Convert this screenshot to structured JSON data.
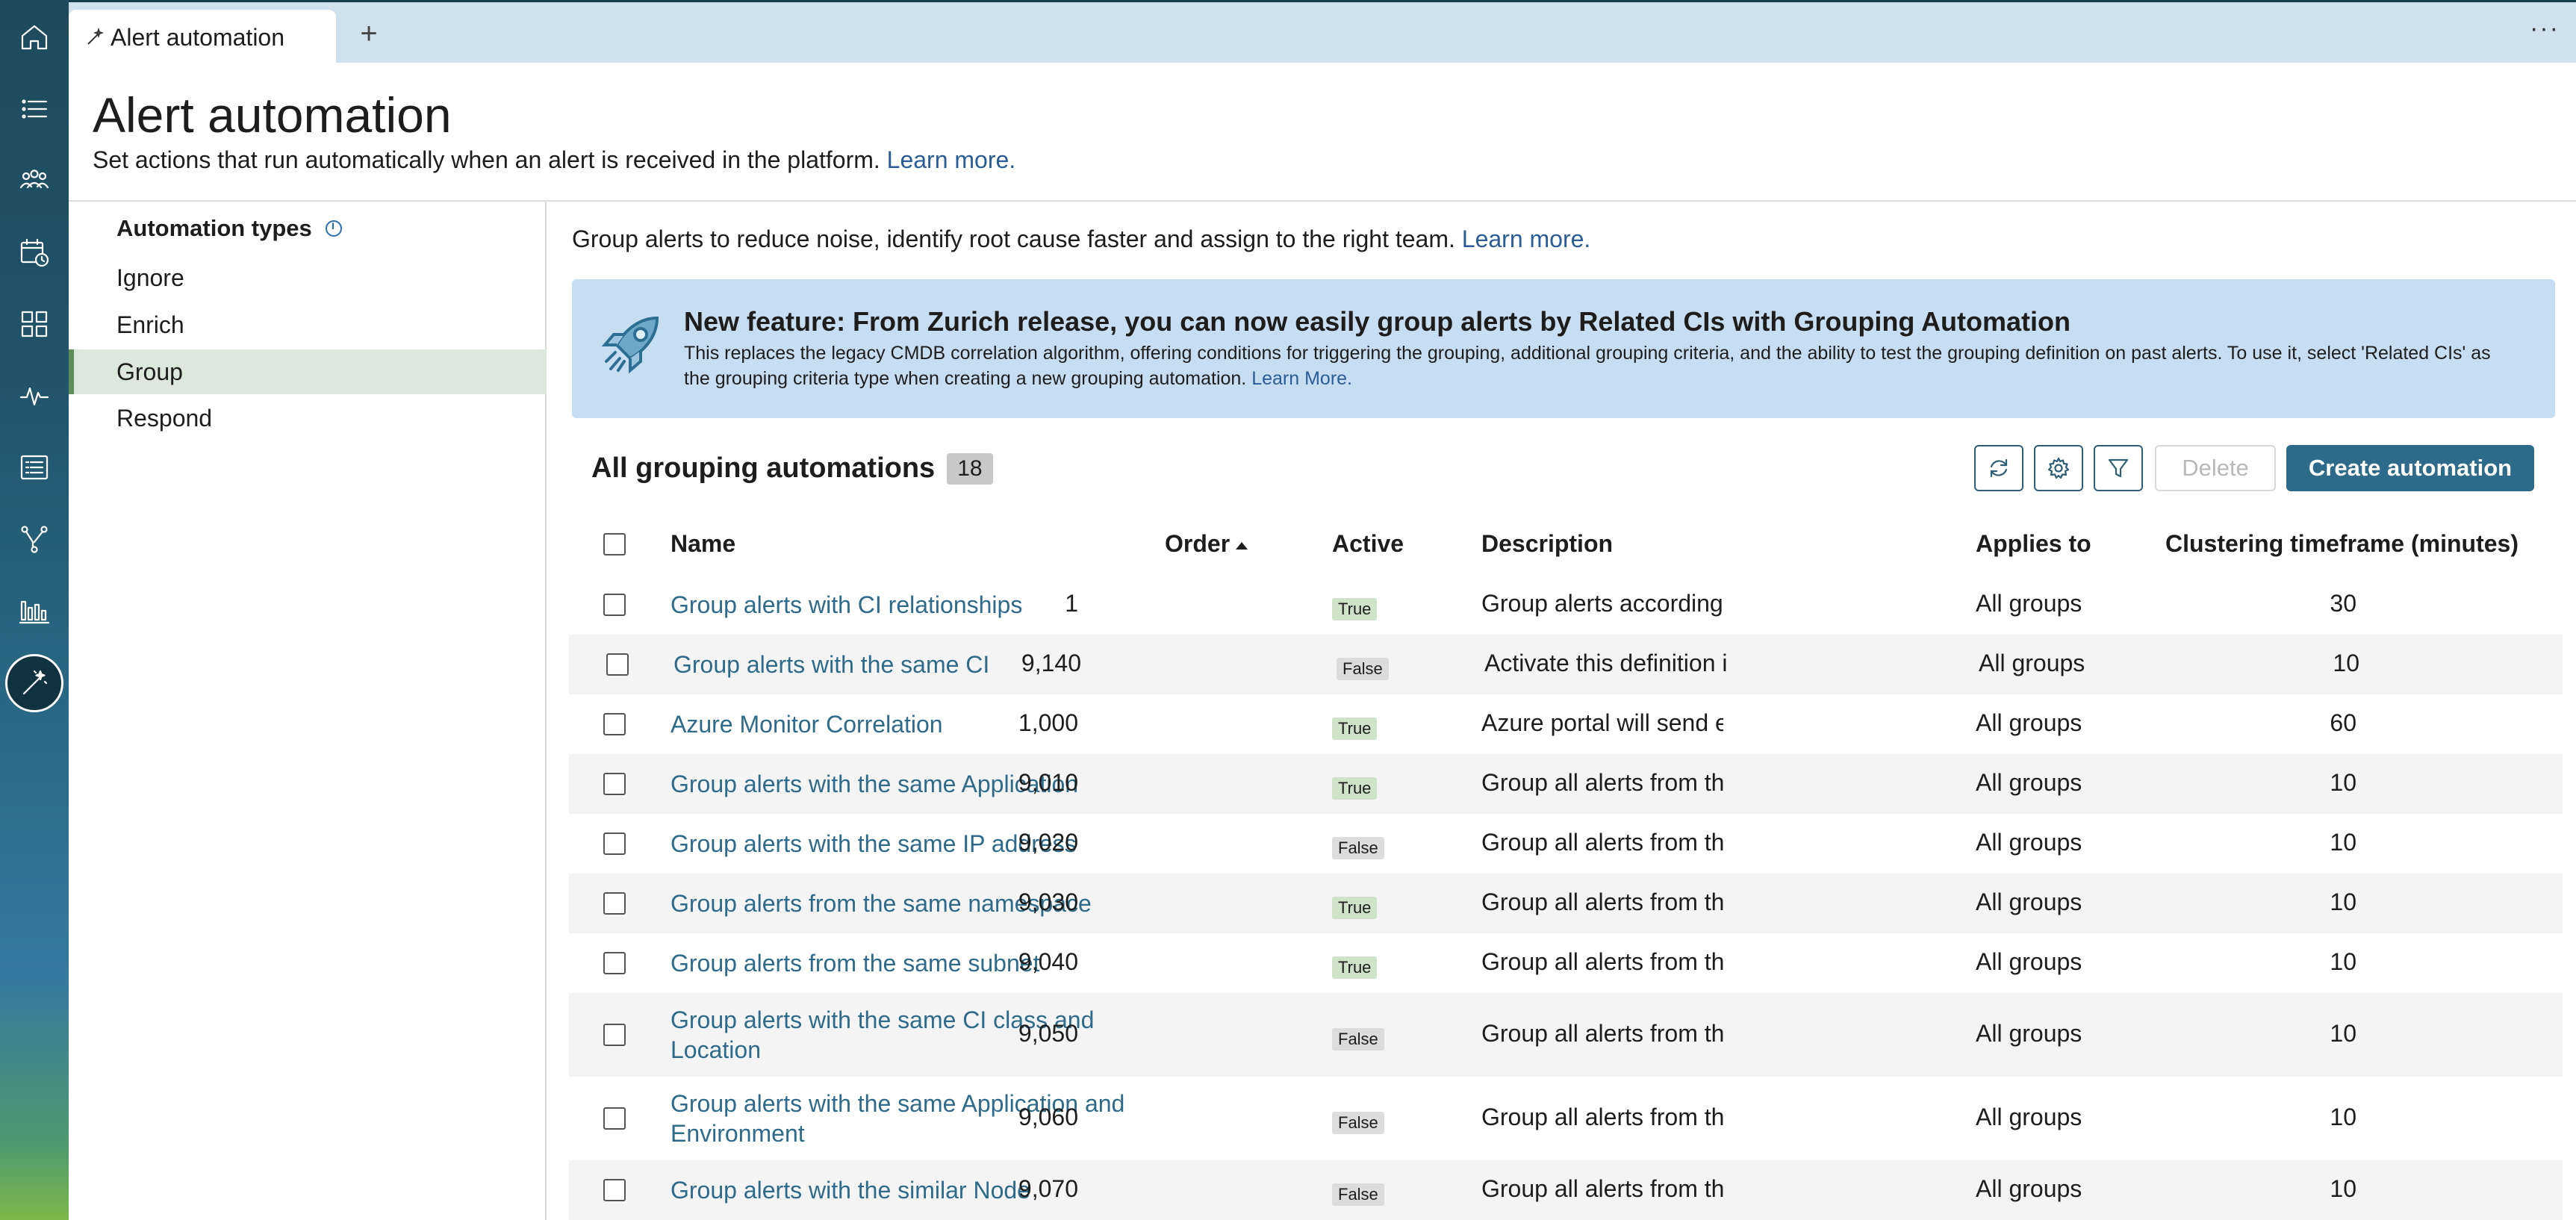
{
  "rail": {
    "items": [
      "home-icon",
      "list-icon",
      "teams-icon",
      "calendar-icon",
      "grid-icon",
      "pulse-icon",
      "document-list-icon",
      "flow-icon",
      "bar-chart-icon",
      "magic-wand-icon"
    ]
  },
  "tabs": {
    "active_label": "Alert automation",
    "add_label": "+",
    "more_label": "···"
  },
  "header": {
    "title": "Alert automation",
    "subtitle": "Set actions that run automatically when an alert is received in the platform.",
    "learn_more": "Learn more."
  },
  "types": {
    "heading": "Automation types",
    "items": [
      "Ignore",
      "Enrich",
      "Group",
      "Respond"
    ],
    "selected": "Group"
  },
  "main": {
    "intro": "Group alerts to reduce noise, identify root cause faster and assign to the right team.",
    "intro_link": "Learn more."
  },
  "banner": {
    "title": "New feature: From Zurich release, you can now easily group alerts by Related CIs with Grouping Automation",
    "text": "This replaces the legacy CMDB correlation algorithm, offering conditions for triggering the grouping, additional grouping criteria, and the ability to test the grouping definition on past alerts. To use it, select 'Related CIs' as the grouping criteria type when creating a new grouping automation.",
    "link": "Learn More."
  },
  "list": {
    "title": "All grouping automations",
    "count": "18",
    "delete_label": "Delete",
    "create_label": "Create automation"
  },
  "table": {
    "columns": {
      "name": "Name",
      "order": "Order",
      "active": "Active",
      "description": "Description",
      "applies_to": "Applies to",
      "cluster": "Clustering timeframe (minutes)"
    },
    "rows": [
      {
        "name": "Group alerts with CI relationships",
        "order": "1",
        "active": "True",
        "description": "Group alerts according to their related configuration items",
        "applies_to": "All groups",
        "cluster": "30"
      },
      {
        "name": "Group alerts with the same CI",
        "order": "9,140",
        "active": "False",
        "description": "Activate this definition in case the CMDB is not populated",
        "applies_to": "All groups",
        "cluster": "10"
      },
      {
        "name": "Azure Monitor Correlation",
        "order": "1,000",
        "active": "True",
        "description": "Azure portal will send events to Azurre Monitor",
        "applies_to": "All groups",
        "cluster": "60"
      },
      {
        "name": "Group alerts with the same Application",
        "order": "9,010",
        "active": "True",
        "description": "Group all alerts from the same application",
        "applies_to": "All groups",
        "cluster": "10"
      },
      {
        "name": "Group alerts with the same IP address",
        "order": "9,020",
        "active": "False",
        "description": "Group all alerts from the same ip_address",
        "applies_to": "All groups",
        "cluster": "10"
      },
      {
        "name": "Group alerts from the same namespace",
        "order": "9,030",
        "active": "True",
        "description": "Group all alerts from the same namespace",
        "applies_to": "All groups",
        "cluster": "10"
      },
      {
        "name": "Group alerts from the same subnet",
        "order": "9,040",
        "active": "True",
        "description": "Group all alerts from the same subnet, cluster",
        "applies_to": "All groups",
        "cluster": "10"
      },
      {
        "name": "Group alerts with the same CI class and Location",
        "order": "9,050",
        "active": "False",
        "description": "Group all alerts from the same CI class and location",
        "applies_to": "All groups",
        "cluster": "10"
      },
      {
        "name": "Group alerts with the same Application and Environment",
        "order": "9,060",
        "active": "False",
        "description": "Group all alerts from the same application and environment",
        "applies_to": "All groups",
        "cluster": "10"
      },
      {
        "name": "Group alerts with the similar Node",
        "order": "9,070",
        "active": "False",
        "description": "Group all alerts from the similar node name",
        "applies_to": "All groups",
        "cluster": "10"
      }
    ]
  }
}
